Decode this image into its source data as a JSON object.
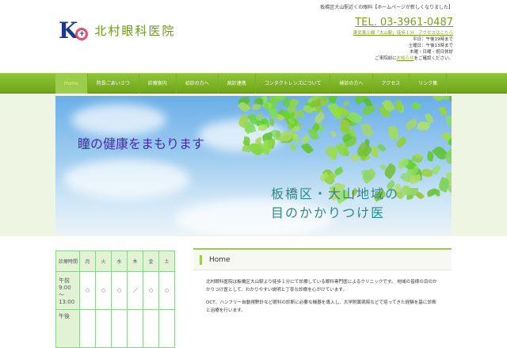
{
  "header": {
    "logo_text": "KC",
    "clinic_name": "北村眼科医院",
    "tagline": "板橋区大山駅近くの眼科【ホームページが新しくなりました】",
    "tel": "TEL. 03-3961-0487",
    "access_link": "東武東上線「大山駅」徒歩１分　アクセスはこちら",
    "hours_lines": [
      "平日：午後19時まで",
      "土曜日：午後13時まで",
      "木曜・日曜・祝日休診"
    ],
    "notice_pre": "ご来院前に",
    "notice_link": "お知らせ",
    "notice_post": "をご確認ください。"
  },
  "nav": {
    "items": [
      {
        "label": "Home",
        "active": true
      },
      {
        "label": "院長ごあいさつ"
      },
      {
        "label": "診療案内"
      },
      {
        "label": "初診の方へ"
      },
      {
        "label": "病診連携"
      },
      {
        "label": "コンタクトレンズについて"
      },
      {
        "label": "検診の方へ"
      },
      {
        "label": "アクセス"
      },
      {
        "label": "リンク集"
      }
    ]
  },
  "hero": {
    "slogan": "瞳の健康をまもります",
    "area_line1": "板橋区・大山地域の",
    "area_line2": "目のかかりつけ医"
  },
  "hours_table": {
    "header": [
      "診療時間",
      "月",
      "火",
      "水",
      "木",
      "金",
      "土"
    ],
    "rows": [
      {
        "label": "午前\n9:00\n〜\n13:00",
        "cells": [
          "○",
          "○",
          "○",
          "／",
          "○",
          "○"
        ]
      },
      {
        "label": "午後",
        "cells": [
          "",
          "",
          "",
          "",
          "",
          ""
        ]
      }
    ]
  },
  "main": {
    "title": "Home",
    "paragraphs": [
      "北村眼科医院は板橋区大山駅より徒歩１分にて診療している眼科専門医によるクリニックです。 地域の皆様の目のかかりつけ医として、わかりやすい説明と丁寧な診療を心がけています。",
      "OCT、ハンフリー自動視野計など眼科の診断に必要な機器を導入し、大学附属病院などで培ってきた経験を基に診断と治療を行います。"
    ]
  }
}
